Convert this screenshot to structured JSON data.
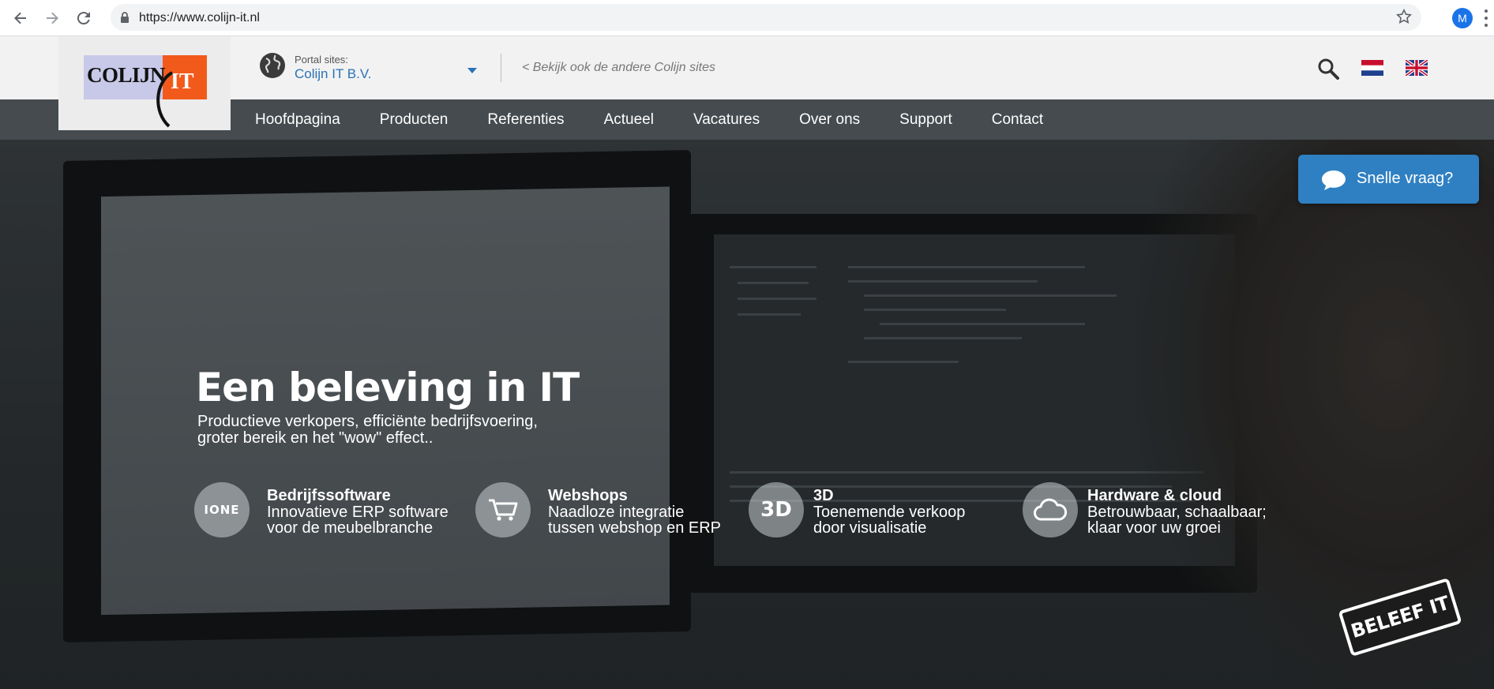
{
  "browser": {
    "url": "https://www.colijn-it.nl",
    "profile_initial": "M",
    "icons": [
      "back-icon",
      "forward-icon",
      "reload-icon",
      "lock-icon",
      "star-icon",
      "menu-dots-icon"
    ]
  },
  "header": {
    "logo_text": "COLIJN",
    "logo_it": "IT",
    "portal_label": "Portal sites:",
    "portal_value": "Colijn IT B.V.",
    "other_sites": "< Bekijk ook de andere Colijn sites",
    "icons": [
      "globe-icon",
      "search-icon",
      "flag-nl-icon",
      "flag-en-icon"
    ]
  },
  "nav": {
    "items": [
      "Hoofdpagina",
      "Producten",
      "Referenties",
      "Actueel",
      "Vacatures",
      "Over ons",
      "Support",
      "Contact"
    ]
  },
  "hero": {
    "title": "Een beleving in IT",
    "subtitle_line1": "Productieve verkopers, efficiënte bedrijfsvoering,",
    "subtitle_line2": "groter bereik en het \"wow\" effect..",
    "quick_question": "Snelle vraag?",
    "stamp": "BELEEF IT",
    "features": [
      {
        "icon_label": "IONE",
        "title": "Bedrijfssoftware",
        "line1": "Innovatieve ERP software",
        "line2": "voor de meubelbranche"
      },
      {
        "icon_label": "",
        "title": "Webshops",
        "line1": "Naadloze integratie",
        "line2": "tussen webshop en ERP"
      },
      {
        "icon_label": "3D",
        "title": "3D",
        "line1": "Toenemende verkoop",
        "line2": "door visualisatie"
      },
      {
        "icon_label": "",
        "title": "Hardware & cloud",
        "line1": "Betrouwbaar, schaalbaar;",
        "line2": "klaar voor uw groei"
      }
    ]
  },
  "colors": {
    "nav_bg": "#454b4f",
    "link_blue": "#2a72b5",
    "quick_button": "#2f80c2",
    "logo_orange": "#f25a1b"
  }
}
